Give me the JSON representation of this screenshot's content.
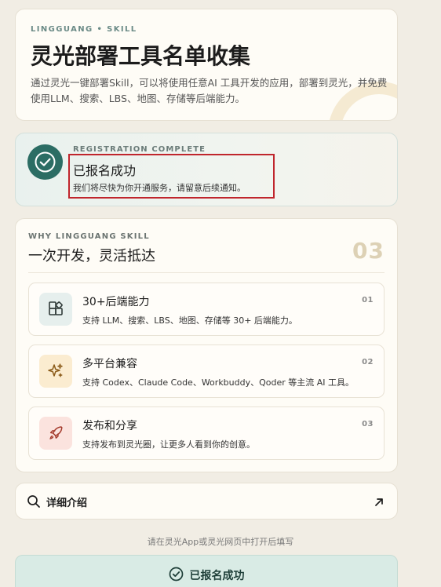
{
  "hero": {
    "eyebrow": "LINGGUANG • SKILL",
    "title": "灵光部署工具名单收集",
    "description": "通过灵光一键部署Skill，可以将使用任意AI 工具开发的应用，部署到灵光，并免费使用LLM、搜索、LBS、地图、存储等后端能力。"
  },
  "success": {
    "eyebrow": "REGISTRATION COMPLETE",
    "status": "已报名成功",
    "note": "我们将尽快为你开通服务，请留意后续通知。",
    "icon": "check-circle-icon"
  },
  "why": {
    "eyebrow": "WHY LINGGUANG SKILL",
    "heading": "一次开发，灵活抵达",
    "count": "03",
    "features": [
      {
        "title": "30+后端能力",
        "desc": "支持 LLM、搜索、LBS、地图、存储等 30+ 后端能力。",
        "num": "01",
        "icon": "grid-blocks-icon"
      },
      {
        "title": "多平台兼容",
        "desc": "支持 Codex、Claude Code、Workbuddy、Qoder 等主流 AI 工具。",
        "num": "02",
        "icon": "sparkle-icon"
      },
      {
        "title": "发布和分享",
        "desc": "支持发布到灵光圈，让更多人看到你的创意。",
        "num": "03",
        "icon": "rocket-icon"
      }
    ]
  },
  "detail": {
    "label": "详细介绍",
    "icon": "search-icon",
    "arrow_icon": "arrow-up-right-icon"
  },
  "hint": "请在灵光App或灵光网页中打开后填写",
  "button": {
    "label": "已报名成功",
    "icon": "check-circle-icon"
  },
  "colors": {
    "background": "#f1ede4",
    "accent": "#2c6d64",
    "highlight_border": "#c0252c",
    "button_bg": "#d9ebe5"
  }
}
